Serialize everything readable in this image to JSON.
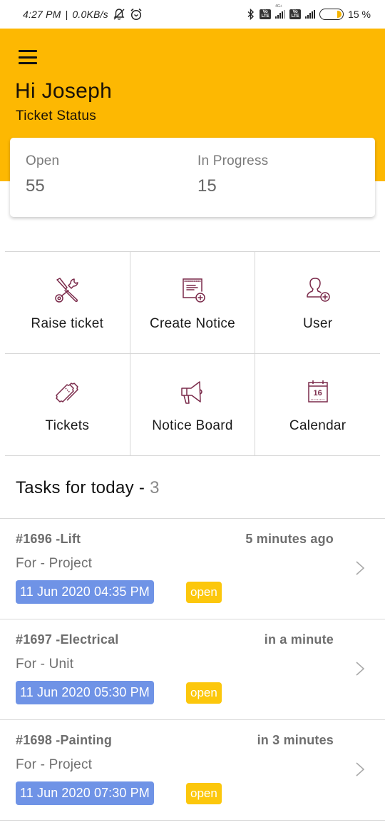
{
  "status_bar": {
    "time": "4:27 PM",
    "separator": "|",
    "speed": "0.0KB/s",
    "network_label": "4G+",
    "volte_top": "Vo",
    "volte_bottom": "LTE",
    "battery_percent": 15,
    "battery_label": "15 %",
    "icons": [
      "mute-notification-icon",
      "alarm-icon",
      "bluetooth-icon",
      "volte-icon",
      "signal-icon",
      "battery-icon"
    ]
  },
  "header": {
    "menu_icon": "hamburger-menu-icon",
    "greeting": "Hi Joseph",
    "subtitle": "Ticket Status",
    "background_color": "#fdb802"
  },
  "ticket_status": {
    "open_label": "Open",
    "open_value": "55",
    "in_progress_label": "In Progress",
    "in_progress_value": "15"
  },
  "menu_grid": {
    "icon_color": "#7a2a4a",
    "items": [
      {
        "label": "Raise ticket",
        "icon": "tools-icon"
      },
      {
        "label": "Create Notice",
        "icon": "add-note-icon"
      },
      {
        "label": "User",
        "icon": "add-user-icon"
      },
      {
        "label": "Tickets",
        "icon": "ticket-icon"
      },
      {
        "label": "Notice Board",
        "icon": "megaphone-icon"
      },
      {
        "label": "Calendar",
        "icon": "calendar-icon",
        "calendar_day": "16"
      }
    ]
  },
  "tasks": {
    "heading": "Tasks for today - ",
    "count": "3",
    "items": [
      {
        "title": "#1696 -Lift",
        "time_ago": "5 minutes ago",
        "for": "For - Project",
        "datetime": "11 Jun 2020 04:35 PM",
        "status": "open"
      },
      {
        "title": "#1697 -Electrical",
        "time_ago": "in a minute",
        "for": "For - Unit",
        "datetime": "11 Jun 2020 05:30 PM",
        "status": "open"
      },
      {
        "title": "#1698 -Painting",
        "time_ago": "in 3 minutes",
        "for": "For - Project",
        "datetime": "11 Jun 2020 07:30 PM",
        "status": "open"
      }
    ],
    "date_badge_color": "#6f93e6",
    "status_badge_color": "#fcc70c"
  }
}
